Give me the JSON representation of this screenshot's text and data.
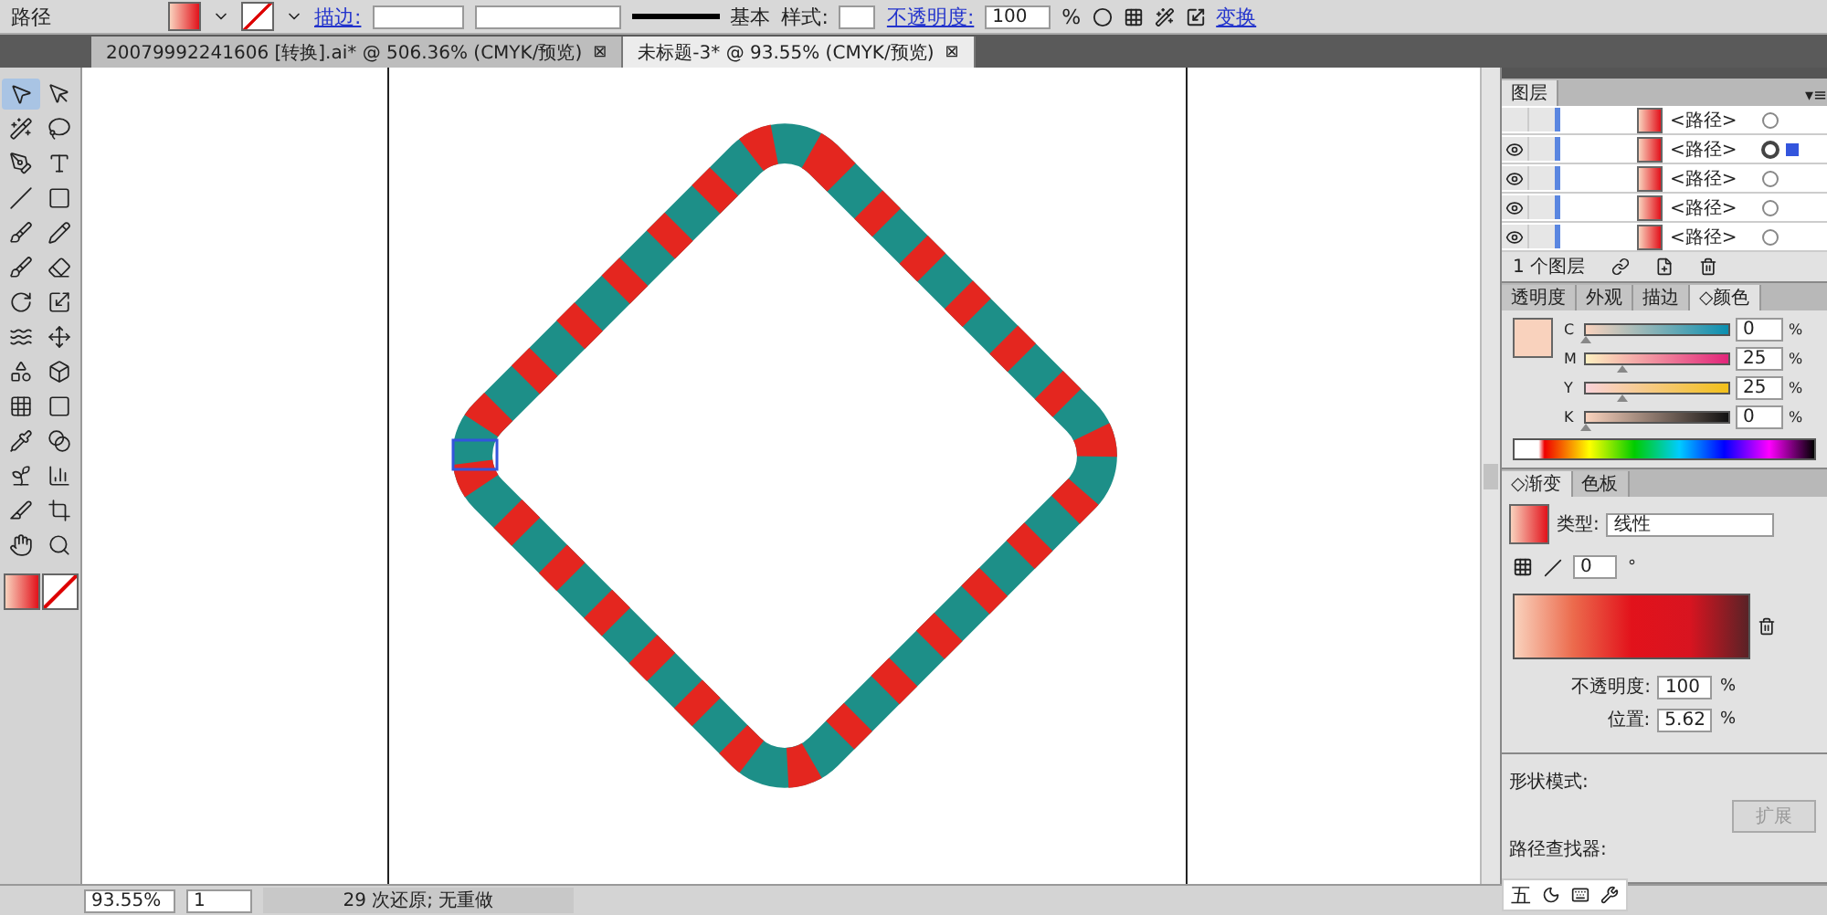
{
  "control_bar": {
    "object_type": "路径",
    "stroke_label": "描边:",
    "stroke_profile": "基本",
    "style_label": "样式:",
    "opacity_label": "不透明度:",
    "opacity_value": "100",
    "opacity_unit": "%",
    "transform_link": "变换"
  },
  "document_tabs": [
    {
      "label": "20079992241606  [转换].ai* @ 506.36% (CMYK/预览)",
      "close": "⊠",
      "selected": false
    },
    {
      "label": "未标题-3* @ 93.55% (CMYK/预览)",
      "close": "⊠",
      "selected": true
    }
  ],
  "tools": [
    {
      "kind": "select",
      "selected": true
    },
    {
      "kind": "direct",
      "selected": false
    },
    {
      "kind": "wand",
      "selected": false
    },
    {
      "kind": "lasso",
      "selected": false
    },
    {
      "kind": "pen",
      "selected": false
    },
    {
      "kind": "type",
      "selected": false
    },
    {
      "kind": "line",
      "selected": false
    },
    {
      "kind": "rect",
      "selected": false
    },
    {
      "kind": "brush",
      "selected": false
    },
    {
      "kind": "pencil",
      "selected": false
    },
    {
      "kind": "blob",
      "selected": false
    },
    {
      "kind": "eraser",
      "selected": false
    },
    {
      "kind": "rotate",
      "selected": false
    },
    {
      "kind": "scale",
      "selected": false
    },
    {
      "kind": "warp",
      "selected": false
    },
    {
      "kind": "transform",
      "selected": false
    },
    {
      "kind": "shape",
      "selected": false
    },
    {
      "kind": "perspective",
      "selected": false
    },
    {
      "kind": "mesh",
      "selected": false
    },
    {
      "kind": "gradient",
      "selected": false
    },
    {
      "kind": "eyedropper",
      "selected": false
    },
    {
      "kind": "blend",
      "selected": false
    },
    {
      "kind": "symbol",
      "selected": false
    },
    {
      "kind": "graph",
      "selected": false
    },
    {
      "kind": "slice",
      "selected": false
    },
    {
      "kind": "knife",
      "selected": false
    },
    {
      "kind": "hand",
      "selected": false
    },
    {
      "kind": "zoom",
      "selected": false
    }
  ],
  "layers_panel": {
    "tab": "图层",
    "menu": "▾≡",
    "rows": [
      {
        "name": "<路径>",
        "visible": false,
        "targeted": false
      },
      {
        "name": "<路径>",
        "visible": true,
        "targeted": true
      },
      {
        "name": "<路径>",
        "visible": true,
        "targeted": false
      },
      {
        "name": "<路径>",
        "visible": true,
        "targeted": false
      },
      {
        "name": "<路径>",
        "visible": true,
        "targeted": false
      }
    ],
    "footer": "1 个图层"
  },
  "color_panel": {
    "tabs": [
      {
        "label": "透明度",
        "selected": false
      },
      {
        "label": "外观",
        "selected": false
      },
      {
        "label": "描边",
        "selected": false
      },
      {
        "label": "◇颜色",
        "selected": true
      }
    ],
    "channels": [
      {
        "name": "C",
        "value": "0",
        "unit": "%",
        "level": 0
      },
      {
        "name": "M",
        "value": "25",
        "unit": "%",
        "level": 0.25
      },
      {
        "name": "Y",
        "value": "25",
        "unit": "%",
        "level": 0.25
      },
      {
        "name": "K",
        "value": "0",
        "unit": "%",
        "level": 0
      }
    ]
  },
  "gradient_panel": {
    "tabs": [
      {
        "label": "◇渐变",
        "selected": true
      },
      {
        "label": "色板",
        "selected": false
      }
    ],
    "type_label": "类型:",
    "type_value": "线性",
    "angle": "0",
    "angle_unit": "°",
    "opacity_label": "不透明度:",
    "opacity_value": "100",
    "opacity_unit": "%",
    "location_label": "位置:",
    "location_value": "5.62",
    "location_unit": "%"
  },
  "pathfinder_panel": {
    "shape_modes_label": "形状模式:",
    "expand_button": "扩展",
    "pathfinders_label": "路径查找器:"
  },
  "ime_bar": {
    "label": "五"
  },
  "status_bar": {
    "zoom": "93.55%",
    "artboard": "1",
    "status": "29 次还原; 无重做"
  }
}
